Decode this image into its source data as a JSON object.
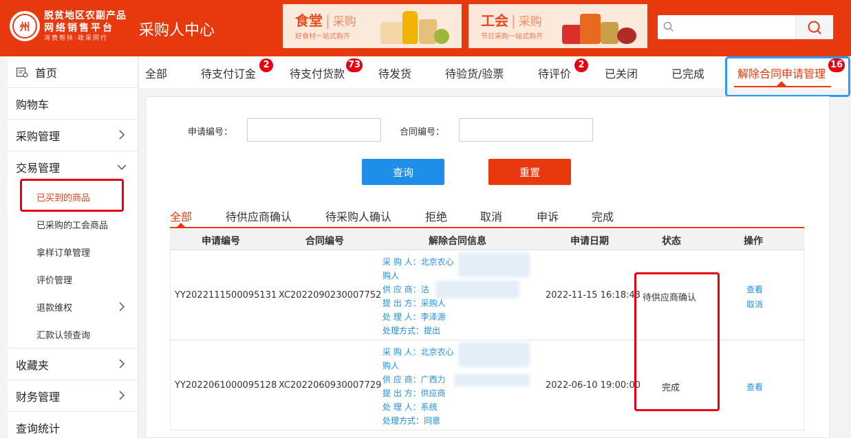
{
  "header": {
    "logo": {
      "emblem_char": "州",
      "line1": "脱贫地区农副产品",
      "line2": "网络销售平台",
      "line3": "消费帮扶·政采同行"
    },
    "center_title": "采购人中心",
    "banners": [
      {
        "title": "食堂",
        "sub_title": "采购",
        "tagline": "好食材一站式购齐"
      },
      {
        "title": "工会",
        "sub_title": "采购",
        "tagline": "节日采购一站式购齐"
      }
    ],
    "search": {
      "placeholder": "",
      "value": ""
    }
  },
  "sidebar": {
    "items": [
      {
        "label": "首页"
      },
      {
        "label": "购物车"
      },
      {
        "label": "采购管理"
      },
      {
        "label": "交易管理"
      }
    ],
    "trade_sub": [
      {
        "label": "已买到的商品"
      },
      {
        "label": "已采购的工会商品"
      },
      {
        "label": "拿样订单管理"
      },
      {
        "label": "评价管理"
      },
      {
        "label": "退款维权"
      },
      {
        "label": "汇款认领查询"
      }
    ],
    "bottom_items": [
      {
        "label": "收藏夹"
      },
      {
        "label": "财务管理"
      },
      {
        "label": "查询统计"
      }
    ]
  },
  "top_tabs": [
    {
      "label": "全部"
    },
    {
      "label": "待支付订金",
      "badge": "2"
    },
    {
      "label": "待支付货款",
      "badge": "73"
    },
    {
      "label": "待发货"
    },
    {
      "label": "待验货/验票"
    },
    {
      "label": "待评价",
      "badge": "2"
    },
    {
      "label": "已关闭"
    },
    {
      "label": "已完成"
    },
    {
      "label": "解除合同申请管理",
      "badge": "16"
    }
  ],
  "form": {
    "apply_no_label": "申请编号：",
    "apply_no_value": "",
    "contract_no_label": "合同编号：",
    "contract_no_value": "",
    "query_label": "查询",
    "reset_label": "重置"
  },
  "sub_tabs": [
    {
      "label": "全部"
    },
    {
      "label": "待供应商确认"
    },
    {
      "label": "待采购人确认"
    },
    {
      "label": "拒绝"
    },
    {
      "label": "取消"
    },
    {
      "label": "申诉"
    },
    {
      "label": "完成"
    }
  ],
  "table": {
    "columns": [
      "申请编号",
      "合同编号",
      "解除合同信息",
      "申请日期",
      "状态",
      "操作"
    ],
    "rows": [
      {
        "apply_no": "YY2022111500095131",
        "contract_no": "XC2022090230007752",
        "info": [
          "采 购 人：北京农心",
          "购人",
          "供 应 商：沽",
          "提 出 方：采购人",
          "处 理 人：李泽源",
          "处理方式：提出"
        ],
        "date": "2022-11-15 16:18:43",
        "status": "待供应商确认",
        "ops": [
          "查看",
          "取消"
        ]
      },
      {
        "apply_no": "YY2022061000095128",
        "contract_no": "XC2022060930007729",
        "info": [
          "采 购 人：北京农心",
          "购人",
          "供 应 商：广西力",
          "提 出 方：供应商",
          "处 理 人：系统",
          "处理方式：同意"
        ],
        "date": "2022-06-10 19:00:00",
        "status": "完成",
        "ops": [
          "查看"
        ]
      }
    ]
  },
  "colors": {
    "brand_red": "#e8380d",
    "link_blue": "#1e8ee8",
    "badge_red": "#e60012",
    "highlight_blue": "#2b9af3"
  }
}
